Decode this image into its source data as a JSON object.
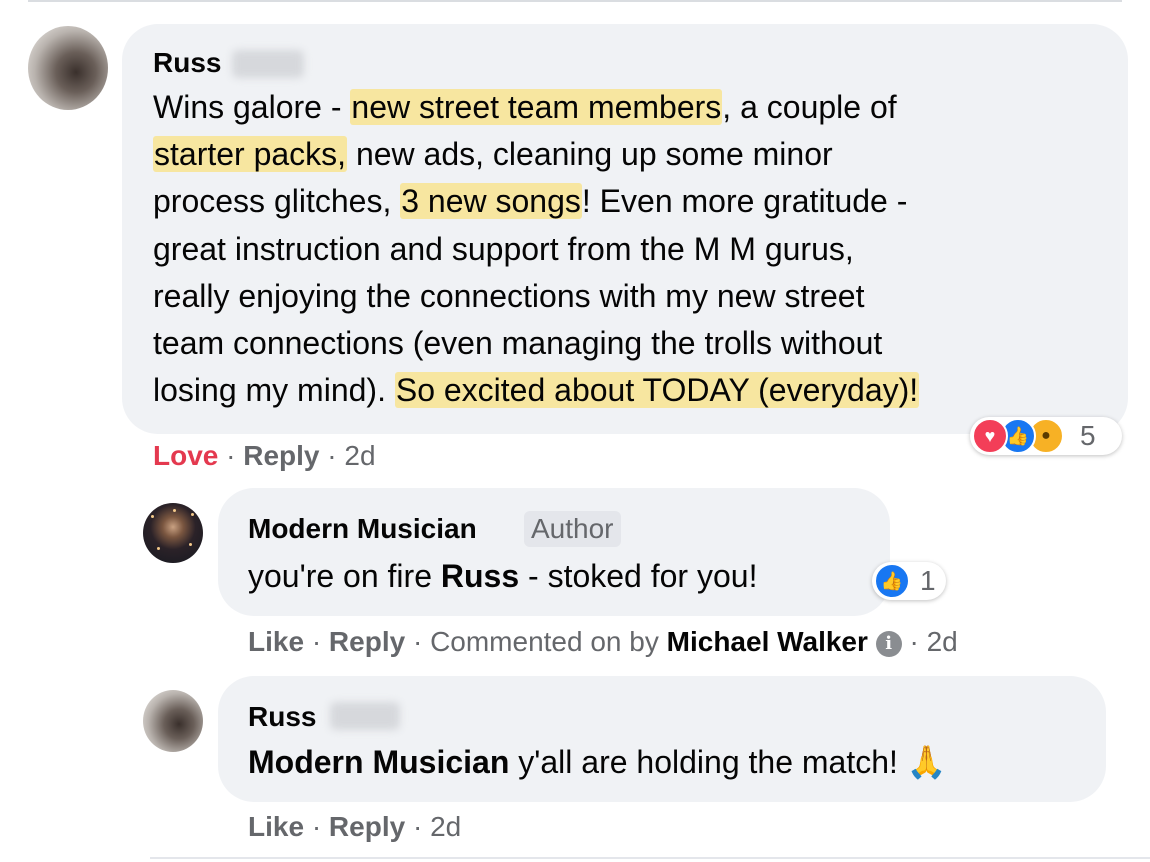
{
  "comments": [
    {
      "author": "Russ",
      "lines": [
        [
          {
            "t": "Wins galore - "
          },
          {
            "t": "new street team members",
            "hl": true
          },
          {
            "t": ", a couple of"
          }
        ],
        [
          {
            "t": "starter packs,",
            "hl": true
          },
          {
            "t": " new ads, cleaning up some minor"
          }
        ],
        [
          {
            "t": "process glitches, "
          },
          {
            "t": "3 new songs",
            "hl": true
          },
          {
            "t": "! Even more gratitude -"
          }
        ],
        [
          {
            "t": "great instruction and support from the M M gurus,"
          }
        ],
        [
          {
            "t": "really enjoying the connections with my new street"
          }
        ],
        [
          {
            "t": "team connections (even managing the trolls without"
          }
        ],
        [
          {
            "t": "losing my mind). "
          },
          {
            "t": "So excited about TODAY (everyday)!",
            "hl": true
          }
        ]
      ],
      "actions": {
        "love": "Love",
        "sep": "·",
        "reply": "Reply",
        "time": "2d"
      },
      "reactions": {
        "icons": [
          "love-reaction",
          "like-reaction",
          "wow-reaction"
        ],
        "count": "5"
      }
    },
    {
      "author": "Modern Musician",
      "badge": "Author",
      "text_before": "you're on fire ",
      "text_bold": "Russ",
      "text_after": " - stoked for you!",
      "actions": {
        "like": "Like",
        "reply": "Reply",
        "commented_on": "Commented on by",
        "commenter": "Michael Walker",
        "time": "2d",
        "sep": "·"
      },
      "reactions": {
        "icons": [
          "like-reaction"
        ],
        "count": "1"
      }
    },
    {
      "author": "Russ",
      "mention": "Modern Musician",
      "text_after": " y'all are holding the match! ",
      "emoji": "🙏",
      "actions": {
        "like": "Like",
        "reply": "Reply",
        "time": "2d",
        "sep": "·"
      }
    }
  ],
  "colors": {
    "love": "#e4394f",
    "like": "#1877f2",
    "wow": "#f7b125",
    "highlight": "#f7e6a0",
    "bubble": "#f0f2f5",
    "meta": "#65676b"
  }
}
